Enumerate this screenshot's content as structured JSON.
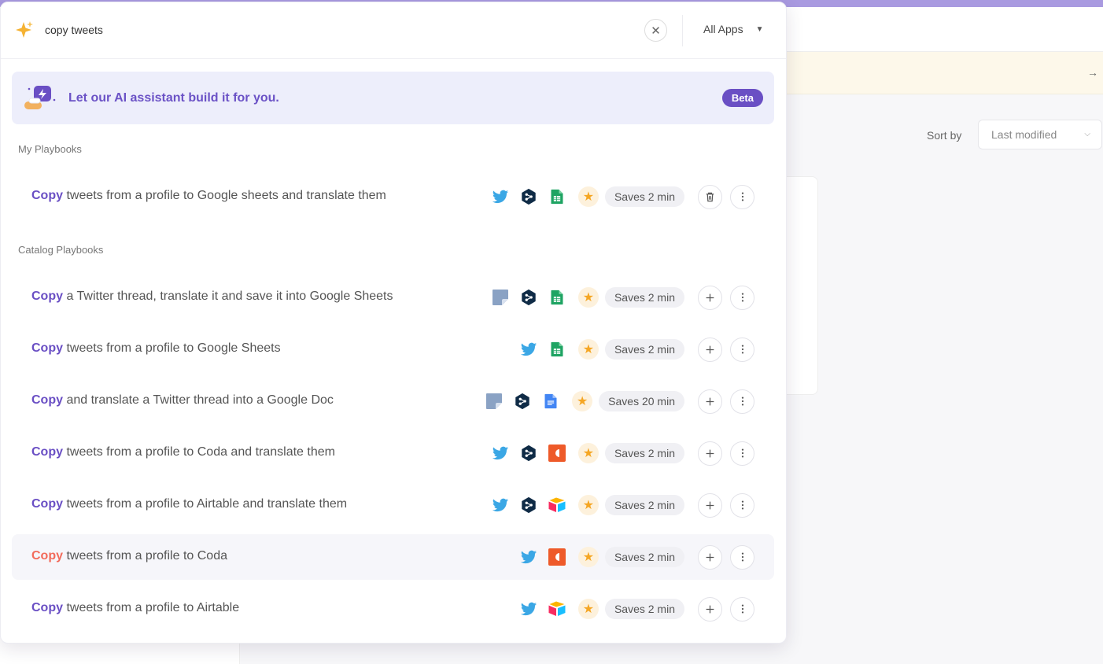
{
  "search": {
    "value": "copy tweets",
    "filter_label": "All Apps"
  },
  "ai_banner": {
    "text": "Let our AI assistant build it for you.",
    "badge": "Beta"
  },
  "sections": {
    "my": "My Playbooks",
    "catalog": "Catalog Playbooks"
  },
  "background": {
    "sort_label": "Sort by",
    "sort_value": "Last modified"
  },
  "my_playbooks": [
    {
      "keyword": "Copy",
      "rest": " tweets from a profile to Google sheets and translate them",
      "apps": [
        "twitter-icon",
        "deepl-icon",
        "google-sheets-icon"
      ],
      "saves": "Saves 2 min",
      "action": "delete"
    }
  ],
  "catalog_playbooks": [
    {
      "keyword": "Copy",
      "rest": " a Twitter thread, translate it and save it into Google Sheets",
      "apps": [
        "sticky-note-icon",
        "deepl-icon",
        "google-sheets-icon"
      ],
      "saves": "Saves 2 min"
    },
    {
      "keyword": "Copy",
      "rest": " tweets from a profile to Google Sheets",
      "apps": [
        "twitter-icon",
        "google-sheets-icon"
      ],
      "saves": "Saves 2 min"
    },
    {
      "keyword": "Copy",
      "rest": " and translate a Twitter thread into a Google Doc",
      "apps": [
        "sticky-note-icon",
        "deepl-icon",
        "google-docs-icon"
      ],
      "saves": "Saves 20 min"
    },
    {
      "keyword": "Copy",
      "rest": " tweets from a profile to Coda and translate them",
      "apps": [
        "twitter-icon",
        "deepl-icon",
        "coda-icon"
      ],
      "saves": "Saves 2 min"
    },
    {
      "keyword": "Copy",
      "rest": " tweets from a profile to Airtable and translate them",
      "apps": [
        "twitter-icon",
        "deepl-icon",
        "airtable-icon"
      ],
      "saves": "Saves 2 min"
    },
    {
      "keyword": "Copy",
      "rest": " tweets from a profile to Coda",
      "apps": [
        "twitter-icon",
        "coda-icon"
      ],
      "saves": "Saves 2 min",
      "highlighted": true
    },
    {
      "keyword": "Copy",
      "rest": " tweets from a profile to Airtable",
      "apps": [
        "twitter-icon",
        "airtable-icon"
      ],
      "saves": "Saves 2 min"
    }
  ]
}
